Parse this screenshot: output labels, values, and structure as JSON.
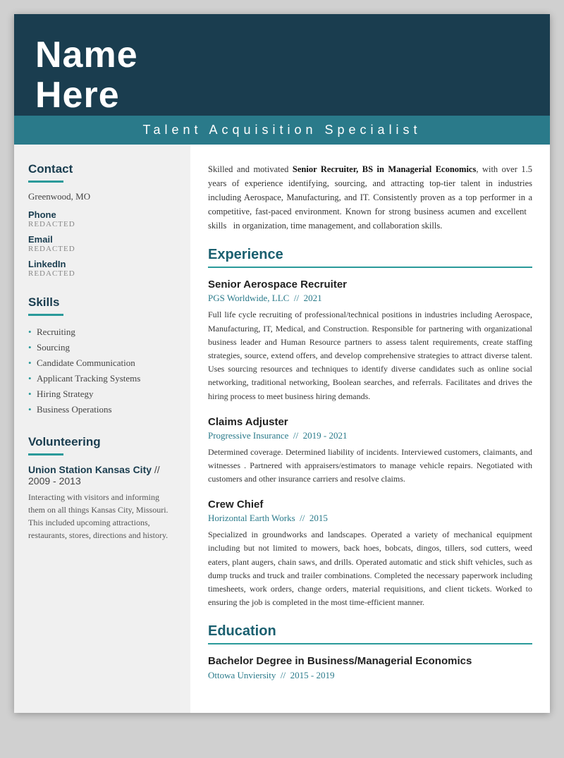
{
  "header": {
    "name_line1": "Name",
    "name_line2": "Here",
    "title": "Talent Acquisition Specialist"
  },
  "sidebar": {
    "contact_section_label": "Contact",
    "city": "Greenwood, MO",
    "phone_label": "Phone",
    "phone_value": "REDACTED",
    "email_label": "Email",
    "email_value": "REDACTED",
    "linkedin_label": "LinkedIn",
    "linkedin_value": "REDACTED",
    "skills_section_label": "Skills",
    "skills": [
      "Recruiting",
      "Sourcing",
      "Candidate Communication",
      "Applicant Tracking Systems",
      "Hiring Strategy",
      "Business Operations"
    ],
    "volunteering_section_label": "Volunteering",
    "vol_org": "Union Station Kansas City",
    "vol_years": "// 2009 - 2013",
    "vol_desc": "Interacting with visitors and informing them on all things Kansas City, Missouri. This included upcoming attractions, restaurants, stores, directions and history."
  },
  "main": {
    "summary": {
      "text_pre": "Skilled and motivated ",
      "text_bold": "Senior Recruiter, BS in Managerial Economics",
      "text_post": ", with over 1.5 years of experience identifying, sourcing, and attracting top-tier talent in industries including Aerospace, Manufacturing, and IT. Consistently proven as a top performer in a competitive, fast-paced environment. Known for strong business acumen and excellent  skills  in organization, time management, and collaboration skills."
    },
    "experience_label": "Experience",
    "experience_items": [
      {
        "title": "Senior Aerospace Recruiter",
        "company": "PGS Worldwide, LLC  //  2021",
        "desc": "Full life cycle recruiting of professional/technical positions in industries including Aerospace, Manufacturing, IT, Medical, and Construction. Responsible for partnering with organizational business leader and Human Resource partners to assess talent requirements, create staffing strategies, source, extend offers, and develop comprehensive strategies to attract diverse talent. Uses sourcing resources and techniques to identify diverse candidates such as online social networking, traditional networking, Boolean searches, and referrals. Facilitates and drives the hiring process to meet business hiring demands."
      },
      {
        "title": "Claims Adjuster",
        "company": "Progressive Insurance  //  2019 - 2021",
        "desc": "Determined coverage. Determined liability of incidents. Interviewed customers, claimants, and witnesses . Partnered with appraisers/estimators to manage vehicle repairs. Negotiated with customers and other insurance carriers and resolve claims."
      },
      {
        "title": "Crew Chief",
        "company": "Horizontal Earth Works  //  2015",
        "desc": "Specialized in groundworks and landscapes. Operated a variety of mechanical equipment including but not limited to mowers, back hoes, bobcats, dingos, tillers, sod cutters, weed eaters, plant augers, chain saws, and drills. Operated automatic and stick shift vehicles, such as dump trucks and truck and trailer combinations. Completed the necessary paperwork including timesheets, work orders, change orders, material requisitions, and client tickets. Worked to ensuring the job is completed in the most time-efficient manner."
      }
    ],
    "education_label": "Education",
    "education_items": [
      {
        "degree": "Bachelor Degree in Business/Managerial Economics",
        "school": "Ottowa Unviersity  //  2015 - 2019"
      }
    ]
  }
}
